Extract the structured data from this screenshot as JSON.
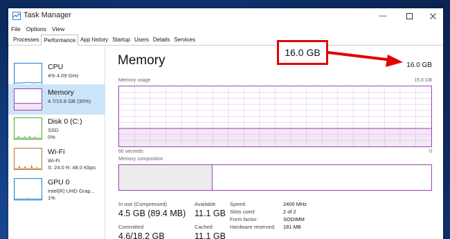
{
  "window": {
    "title": "Task Manager"
  },
  "menu": [
    "File",
    "Options",
    "View"
  ],
  "tabs": [
    "Processes",
    "Performance",
    "App history",
    "Startup",
    "Users",
    "Details",
    "Services"
  ],
  "sidebar": [
    {
      "name": "CPU",
      "sub1": "4% 4.09 GHz",
      "sub2": "",
      "sub3": "",
      "color": "#1a7ed1"
    },
    {
      "name": "Memory",
      "sub1": "4.7/15.8 GB (30%)",
      "sub2": "",
      "sub3": "",
      "color": "#9b3fb5"
    },
    {
      "name": "Disk 0 (C:)",
      "sub1": "SSD",
      "sub2": "0%",
      "sub3": "",
      "color": "#4aa832"
    },
    {
      "name": "Wi-Fi",
      "sub1": "Wi-Fi",
      "sub2": "S: 24.0  R: 48.0 Kbps",
      "sub3": "",
      "color": "#b5762a"
    },
    {
      "name": "GPU 0",
      "sub1": "Intel(R) UHD Grap...",
      "sub2": "1%",
      "sub3": "",
      "color": "#1a7ed1"
    }
  ],
  "main": {
    "title": "Memory",
    "total": "16.0 GB",
    "usage_label": "Memory usage",
    "usage_max": "15.8 GB",
    "time_left": "60 seconds",
    "time_right": "0",
    "composition_label": "Memory composition",
    "usage_fraction": 0.3,
    "composition_fraction": 0.3
  },
  "stats": {
    "in_use_label": "In use (Compressed)",
    "in_use_value": "4.5 GB (89.4 MB)",
    "available_label": "Available",
    "available_value": "11.1 GB",
    "committed_label": "Committed",
    "committed_value": "4.6/18.2 GB",
    "cached_label": "Cached",
    "cached_value": "11.1 GB"
  },
  "details": [
    {
      "label": "Speed:",
      "value": "2400 MHz"
    },
    {
      "label": "Slots used:",
      "value": "2 of 2"
    },
    {
      "label": "Form factor:",
      "value": "SODIMM"
    },
    {
      "label": "Hardware reserved:",
      "value": "181 MB"
    }
  ],
  "callout": {
    "text": "16.0 GB",
    "color": "#e00000"
  },
  "colors": {
    "memory": "#9b3fb5",
    "selected": "#cce4f7"
  }
}
